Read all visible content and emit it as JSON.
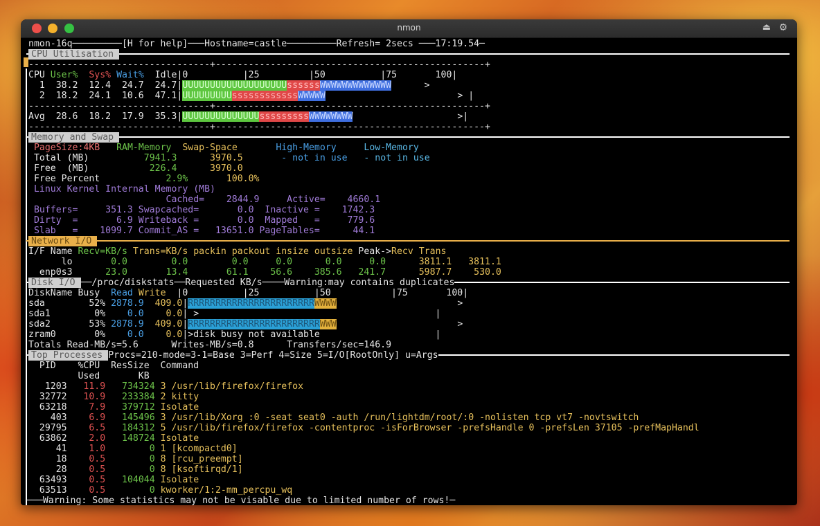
{
  "window": {
    "title": "nmon"
  },
  "top": {
    "text": "nmon-16q─────────[H for help]───Hostname=castle─────────Refresh= 2secs ───17:19.54─"
  },
  "cpu": {
    "header": "CPU Utilisation",
    "dash": "---------------------------------+-------------------------------------------------+",
    "col": {
      "cpu": "CPU ",
      "user": "User%",
      "sys": "Sys%",
      "wait": "Wait%",
      "idle": "Idle",
      "scale": "|0          |25         |50          |75       100|"
    },
    "rows": [
      {
        "pre": "  1  38.2  12.4  24.7  24.7|",
        "u": "UUUUUUUUUUUUUUUUUUU",
        "s": "ssssss",
        "w": "WWWWWWWWWWWWW",
        "end": "      >"
      },
      {
        "pre": "  2  18.2  24.1  10.6  47.1|",
        "u": "UUUUUUUUU",
        "s": "ssssssssssss",
        "w": "WWWWW",
        "end": "                        > |"
      }
    ],
    "avg": {
      "pre": "Avg  28.6  18.2  17.9  35.3|",
      "u": "UUUUUUUUUUUUUU",
      "s": "sssssssss",
      "w": "WWWWWWWW",
      "end": "                   >|"
    }
  },
  "mem": {
    "header": "Memory and Swap",
    "l1": {
      "pagesize": "PageSize:4KB",
      "ram": "RAM-Memory",
      "swap": "Swap-Space",
      "high": "High-Memory",
      "low": "Low-Memory"
    },
    "l2": {
      "label": "Total (MB)",
      "ram": "7941.3",
      "swap": "3970.5",
      "high": "- not in use",
      "low": "- not in use"
    },
    "l3": {
      "label": "Free  (MB)",
      "ram": "226.4",
      "swap": "3970.0"
    },
    "l4": {
      "label": "Free Percent",
      "ram": "2.9%",
      "swap": "100.0%"
    },
    "kernel": "Linux Kernel Internal Memory (MB)",
    "k1": "                        Cached=    2844.9     Active=    4660.1",
    "k2": "Buffers=     351.3 Swapcached=       0.0  Inactive =    1742.3",
    "k3": "Dirty  =       6.9 Writeback =       0.0  Mapped   =     779.6",
    "k4": "Slab   =    1099.7 Commit_AS =   13651.0 PageTables=      44.1"
  },
  "net": {
    "header": "Network I/O",
    "h": {
      "a": "I/F Name ",
      "b": "Recv=KB/s",
      "c": " Trans=KB/s packin packout insize outsize ",
      "d": "Peak->",
      "e": "Recv Trans"
    },
    "r1": {
      "name": "      lo",
      "vals": "       0.0        0.0        0.0     0.0      0.0     0.0",
      "peak": "      3811.1   3811.1"
    },
    "r2": {
      "name": "  enp0s3",
      "vals": "      23.0       13.4       61.1    56.6    385.6   241.7",
      "peak": "      5987.7    530.0"
    }
  },
  "disk": {
    "header": "Disk I/O",
    "title_rest": "──/proc/diskstats──Requested KB/s────Warning:may contains duplicates",
    "h": {
      "a": "DiskName Busy  ",
      "read": "Read",
      "write": "Write",
      "b": "  |0          |25          |50           |75       100|"
    },
    "rows": [
      {
        "name": "sda        52% ",
        "read": "2878.9",
        "write": "409.0",
        "bar_r": "RRRRRRRRRRRRRRRRRRRRRRR",
        "bar_w": "WWWW",
        "end": "                      >"
      },
      {
        "name": "sda1        0% ",
        "read": "   0.0",
        "write": "  0.0",
        "bar_r": "",
        "bar_w": "",
        "end": " >                                           |"
      },
      {
        "name": "sda2       53% ",
        "read": "2878.9",
        "write": "409.0",
        "bar_r": "RRRRRRRRRRRRRRRRRRRRRRRR",
        "bar_w": "WWW",
        "end": "                      >"
      },
      {
        "name": "zram0       0% ",
        "read": "   0.0",
        "write": "  0.0",
        "bar_r": "",
        "bar_w": "",
        "end": ">disk busy not available                     |"
      }
    ],
    "totals": "Totals Read-MB/s=5.6      Writes-MB/s=0.8      Transfers/sec=146.9"
  },
  "procs": {
    "header": "Top Processes",
    "title_rest": "Procs=210-mode=3-1=Base 3=Perf 4=Size 5=I/O[RootOnly] u=Args",
    "h1": "  PID    %CPU  ResSize  Command",
    "h2": "         Used       KB",
    "rows": [
      {
        "pid": "   1203",
        "cpu": "11.9",
        "res": "734324",
        "cmd": "3 /usr/lib/firefox/firefox"
      },
      {
        "pid": "  32772",
        "cpu": "10.9",
        "res": "233384",
        "cmd": "2 kitty"
      },
      {
        "pid": "  63218",
        "cpu": " 7.9",
        "res": "379712",
        "cmd": "Isolate"
      },
      {
        "pid": "    403",
        "cpu": " 6.9",
        "res": "145496",
        "cmd": "3 /usr/lib/Xorg :0 -seat seat0 -auth /run/lightdm/root/:0 -nolisten tcp vt7 -novtswitch"
      },
      {
        "pid": "  29795",
        "cpu": " 6.5",
        "res": "184312",
        "cmd": "5 /usr/lib/firefox/firefox -contentproc -isForBrowser -prefsHandle 0 -prefsLen 37105 -prefMapHandl"
      },
      {
        "pid": "  63862",
        "cpu": " 2.0",
        "res": "148724",
        "cmd": "Isolate"
      },
      {
        "pid": "     41",
        "cpu": " 1.0",
        "res": "     0",
        "cmd": "1 [kcompactd0]"
      },
      {
        "pid": "     18",
        "cpu": " 0.5",
        "res": "     0",
        "cmd": "8 [rcu_preempt]"
      },
      {
        "pid": "     28",
        "cpu": " 0.5",
        "res": "     0",
        "cmd": "8 [ksoftirqd/1]"
      },
      {
        "pid": "  63493",
        "cpu": " 0.5",
        "res": "104044",
        "cmd": "Isolate"
      },
      {
        "pid": "  63513",
        "cpu": " 0.5",
        "res": "     0",
        "cmd": "kworker/1:2-mm_percpu_wq"
      }
    ],
    "warning": "───Warning: Some statistics may not be visable due to limited number of rows!─"
  }
}
